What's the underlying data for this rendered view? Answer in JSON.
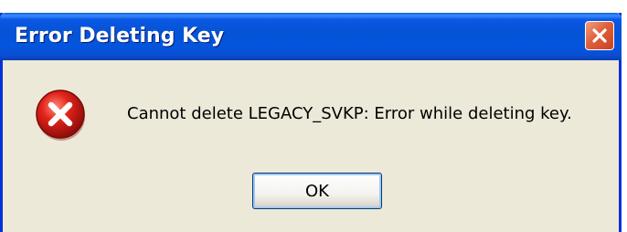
{
  "dialog": {
    "title": "Error Deleting Key",
    "message": "Cannot delete LEGACY_SVKP:  Error while deleting key.",
    "ok_label": "OK",
    "title_bar_color": "#0553d6",
    "body_color": "#ece9d8",
    "close_button_color": "#e0603c"
  },
  "icons": {
    "close": "close-icon",
    "error": "error-icon"
  }
}
